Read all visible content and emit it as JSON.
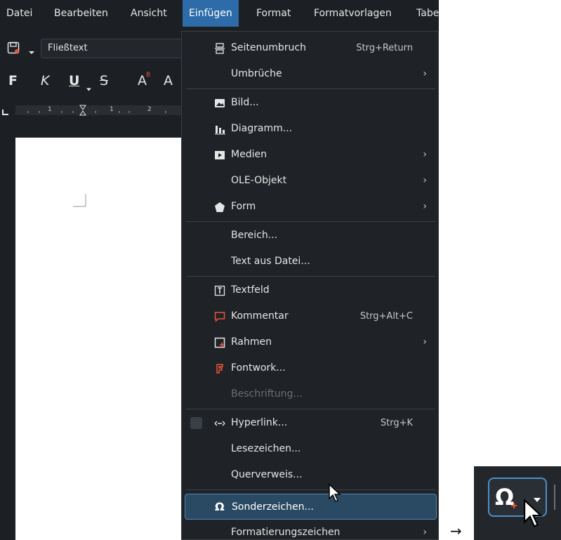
{
  "menubar": {
    "items": [
      {
        "label": "Datei"
      },
      {
        "label": "Bearbeiten"
      },
      {
        "label": "Ansicht"
      },
      {
        "label": "Einfügen"
      },
      {
        "label": "Format"
      },
      {
        "label": "Formatvorlagen"
      },
      {
        "label": "Tabe"
      }
    ],
    "active": "Einfügen"
  },
  "toolbar": {
    "paragraph_style": "Fließtext"
  },
  "format_bar": {
    "bold": "F",
    "italic": "K",
    "underline": "U",
    "strikethrough": "S",
    "superscript": "A",
    "subscript": "A"
  },
  "ruler": {
    "marks": [
      "1",
      "1",
      "2"
    ]
  },
  "insert_menu": {
    "items": [
      {
        "label": "Seitenumbruch",
        "shortcut": "Strg+Return",
        "icon": "page-break-icon"
      },
      {
        "label": "Umbrüche",
        "submenu": true
      },
      {
        "label": "Bild...",
        "icon": "image-icon"
      },
      {
        "label": "Diagramm...",
        "icon": "chart-icon"
      },
      {
        "label": "Medien",
        "submenu": true,
        "icon": "media-icon"
      },
      {
        "label": "OLE-Objekt",
        "submenu": true
      },
      {
        "label": "Form",
        "submenu": true,
        "icon": "shape-icon"
      },
      {
        "label": "Bereich..."
      },
      {
        "label": "Text aus Datei..."
      },
      {
        "label": "Textfeld",
        "icon": "textbox-icon"
      },
      {
        "label": "Kommentar",
        "shortcut": "Strg+Alt+C",
        "icon": "comment-icon"
      },
      {
        "label": "Rahmen",
        "submenu": true,
        "icon": "frame-icon"
      },
      {
        "label": "Fontwork...",
        "icon": "fontwork-icon"
      },
      {
        "label": "Beschriftung...",
        "disabled": true
      },
      {
        "label": "Hyperlink...",
        "shortcut": "Strg+K",
        "icon": "hyperlink-icon"
      },
      {
        "label": "Lesezeichen..."
      },
      {
        "label": "Querverweis..."
      },
      {
        "label": "Sonderzeichen...",
        "icon": "omega-icon",
        "highlighted": true
      },
      {
        "label": "Formatierungszeichen",
        "submenu": true
      }
    ]
  },
  "annotation": {
    "arrow": "→"
  },
  "zoom_inset": {
    "button_symbol": "Ω"
  },
  "colors": {
    "menu_active": "#2d6ca8",
    "highlight": "#2a4a63",
    "highlight_border": "#4f86b5",
    "comment_icon": "#e8533a",
    "page": "#ffffff"
  }
}
